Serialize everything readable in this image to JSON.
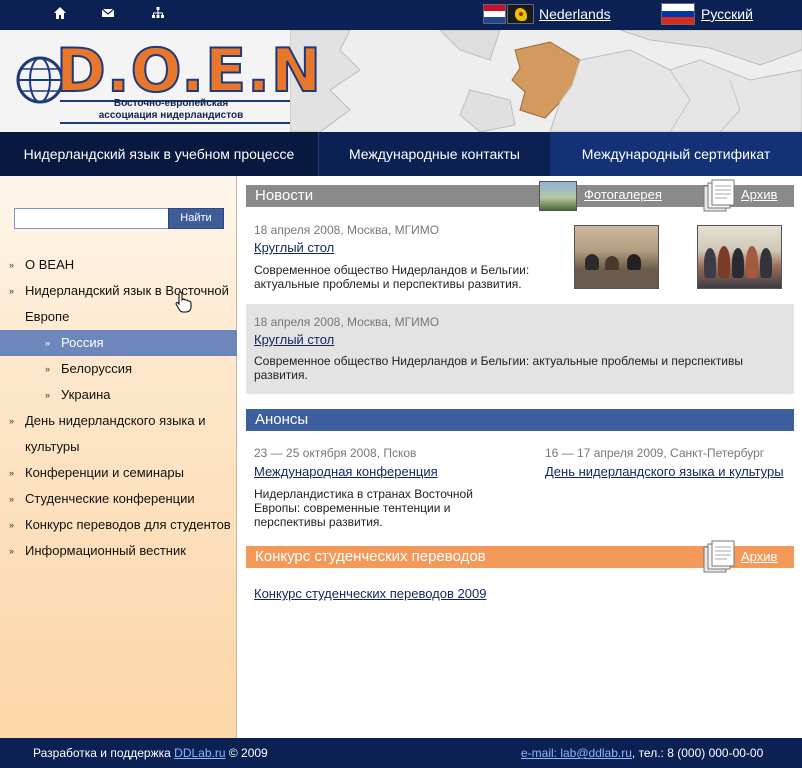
{
  "topbar": {
    "icons": [
      "home-icon",
      "mail-icon",
      "sitemap-icon"
    ],
    "lang_nl": "Nederlands",
    "lang_ru": "Русский"
  },
  "header": {
    "logo_text": "D.O.E.N",
    "logo_sub_line1": "Восточно-европейская",
    "logo_sub_line2": "ассоциация нидерландистов"
  },
  "nav": {
    "items": [
      {
        "label": "Нидерландский язык в учебном процессе"
      },
      {
        "label": "Международные контакты"
      },
      {
        "label": "Международный сертификат"
      }
    ]
  },
  "sidebar": {
    "search_placeholder": "",
    "search_button": "Найти",
    "menu": [
      {
        "label": "О ВЕАН"
      },
      {
        "label": "Нидерландский язык в Восточной"
      },
      {
        "label": "Европе"
      },
      {
        "label": "Россия"
      },
      {
        "label": "Белоруссия"
      },
      {
        "label": "Украина"
      },
      {
        "label": "День нидерландского языка и"
      },
      {
        "label": "культуры"
      },
      {
        "label": "Конференции и семинары"
      },
      {
        "label": "Студенческие конференции"
      },
      {
        "label": "Конкурс переводов для студентов"
      },
      {
        "label": "Информационный вестник"
      }
    ]
  },
  "news": {
    "header": "Новости",
    "gallery_link": "Фотогалерея",
    "archive_link": "Архив",
    "items": [
      {
        "date": "18 апреля 2008, Москва, МГИМО",
        "title": "Круглый стол",
        "text_line1": "Современное общество Нидерландов  и Бельгии:",
        "text_line2": "актуальные проблемы и  перспективы развития."
      },
      {
        "date": "18 апреля 2008, Москва, МГИМО",
        "title": "Круглый стол",
        "text_line1": "Современное общество Нидерландов  и Бельгии: актуальные проблемы и  перспективы",
        "text_line2": "развития."
      }
    ]
  },
  "anons": {
    "header": "Анонсы",
    "items": [
      {
        "date": "23 — 25 октября 2008, Псков",
        "title": "Международная конференция",
        "text_line1": "Нидерландистика в странах Восточной",
        "text_line2": "Европы: современные тентенции и",
        "text_line3": "перспективы развития."
      },
      {
        "date": "16 — 17 апреля 2009, Санкт-Петербург",
        "title": "День нидерландского языка и культуры"
      }
    ]
  },
  "contest": {
    "header": "Конкурс студенческих переводов",
    "archive_link": "Архив",
    "link": "Конкурс студенческих переводов 2009"
  },
  "footer": {
    "dev_text": "Разработка и поддержка",
    "dev_link": "DDLab.ru",
    "dev_year": "© 2009",
    "email_link": "e-mail: lab@ddlab.ru",
    "phone": ", тел.: 8 (000) 000-00-00"
  }
}
